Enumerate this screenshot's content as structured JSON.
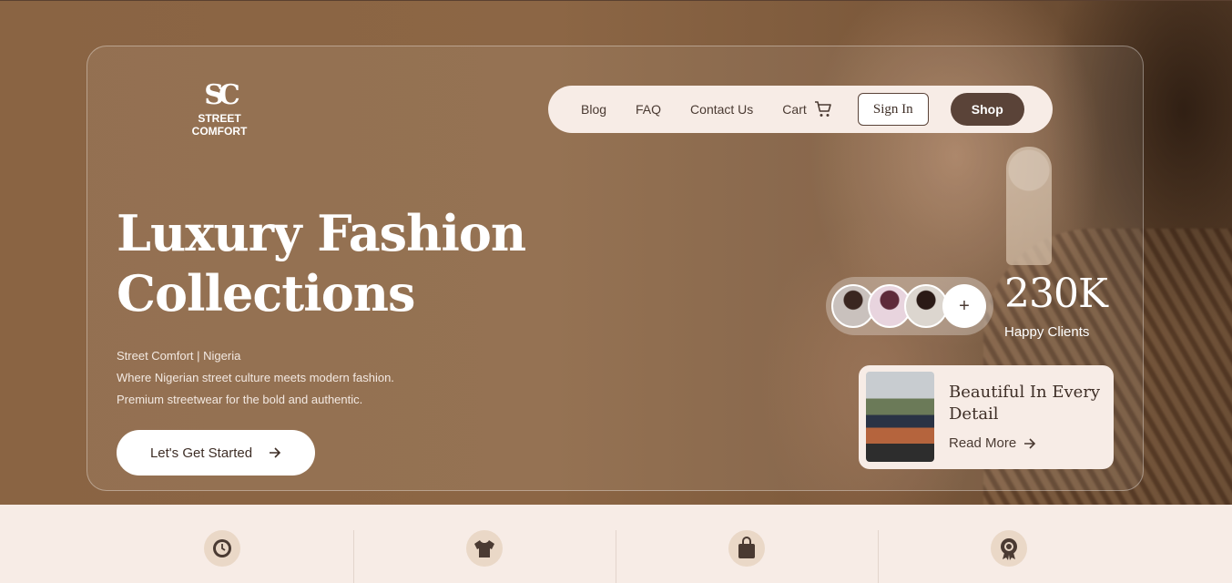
{
  "brand": {
    "mark": "SC",
    "name": "STREET COMFORT"
  },
  "nav": {
    "links": [
      "Blog",
      "FAQ",
      "Contact Us"
    ],
    "cart_label": "Cart",
    "signin_label": "Sign In",
    "shop_label": "Shop"
  },
  "hero": {
    "headline_line1": "Luxury Fashion",
    "headline_line2": "Collections",
    "tagline": [
      "Street Comfort | Nigeria",
      "Where Nigerian street culture meets modern fashion.",
      "Premium streetwear for the bold and authentic."
    ],
    "cta_label": "Let's Get Started"
  },
  "stats": {
    "more_icon": "+",
    "number": "230K",
    "label": "Happy Clients"
  },
  "promo_card": {
    "title": "Beautiful In Every Detail",
    "link_label": "Read More"
  },
  "features": {
    "icons": [
      "clock-icon",
      "sweater-icon",
      "shopping-bag-icon",
      "award-badge-icon"
    ]
  },
  "colors": {
    "accent": "#5a4338",
    "cream": "#f7ece6",
    "hero_brown": "#8a6443",
    "icon_bg": "#ead8c7"
  }
}
